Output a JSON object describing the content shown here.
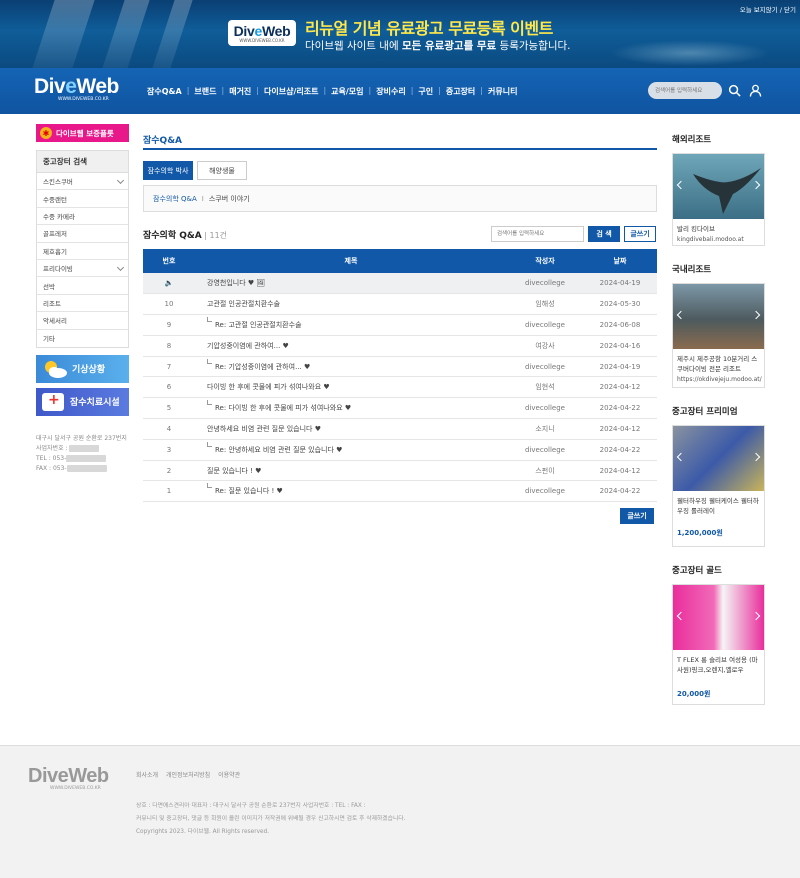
{
  "banner": {
    "logo": "DiveWeb",
    "logo_sub": "WWW.DIVEWEB.CO.KR",
    "headline": "리뉴얼 기념 유료광고 무료등록 이벤트",
    "sub_pre": "다이브웹 사이트 내에 ",
    "sub_bold": "모든 유료광고를 무료",
    "sub_post": " 등록가능합니다.",
    "top_links": "오늘 보지않기 / 닫기"
  },
  "nav": {
    "logo": "DiveWeb",
    "logo_sub": "WWW.DIVEWEB.CO.KR",
    "menu": [
      "잠수Q&A",
      "브랜드",
      "매거진",
      "다이브샵/리조트",
      "교육/모임",
      "장비수리",
      "구인",
      "중고장터",
      "커뮤니티"
    ],
    "search_placeholder": "검색어를 입력하세요"
  },
  "left": {
    "guarantee_btn": "다이브웹 보증플롯",
    "box_title": "중고장터 검색",
    "items": [
      "스킨스쿠버",
      "수중랜턴",
      "수중 카메라",
      "골프레저",
      "제호흡기",
      "프리다이빙",
      "선박",
      "리조트",
      "악세서리",
      "기타"
    ],
    "weather_btn": "기상상황",
    "hospital_btn": "잠수치료시설",
    "addr1": "대구시 달서구 공원 순환로 237번지",
    "addr2": "사업자번호 :",
    "tel": "TEL : 053-",
    "fax": "FAX : 053-"
  },
  "main": {
    "section_title": "잠수Q&A",
    "tabs": [
      "잠수의학 박사",
      "해양생물"
    ],
    "crumb1": "잠수의학 Q&A",
    "crumb_sep": "I",
    "crumb2": "스쿠버 이야기",
    "list_title": "잠수의학 Q&A",
    "list_count": " | 11건",
    "search_placeholder": "검색어를 입력하세요",
    "search_btn": "검 색",
    "write_btn": "글쓰기",
    "columns": [
      "번호",
      "제목",
      "작성자",
      "날짜"
    ],
    "rows": [
      {
        "num": "",
        "subject": "강영천입니다 ♥ 🖼",
        "author": "divecollege",
        "date": "2024-04-19",
        "notice": true,
        "reply": false
      },
      {
        "num": "10",
        "subject": "고관절 인공관절치환수술",
        "author": "임해성",
        "date": "2024-05-30",
        "notice": false,
        "reply": false
      },
      {
        "num": "9",
        "subject": "Re: 고관절 인공관절치환수술",
        "author": "divecollege",
        "date": "2024-06-08",
        "notice": false,
        "reply": true
      },
      {
        "num": "8",
        "subject": "기압성중이염에 관하여... ♥",
        "author": "여강사",
        "date": "2024-04-16",
        "notice": false,
        "reply": false
      },
      {
        "num": "7",
        "subject": "Re: 기압성중이염에 관하여... ♥",
        "author": "divecollege",
        "date": "2024-04-19",
        "notice": false,
        "reply": true
      },
      {
        "num": "6",
        "subject": "다이빙 한 후에 콧물에 피가 섞여나와요 ♥",
        "author": "임현석",
        "date": "2024-04-12",
        "notice": false,
        "reply": false
      },
      {
        "num": "5",
        "subject": "Re: 다이빙 한 후에 콧물에 피가 섞여나와요 ♥",
        "author": "divecollege",
        "date": "2024-04-22",
        "notice": false,
        "reply": true
      },
      {
        "num": "4",
        "subject": "안녕하세요 비염 관련 질문 있습니다 ♥",
        "author": "소지니",
        "date": "2024-04-12",
        "notice": false,
        "reply": false
      },
      {
        "num": "3",
        "subject": "Re: 안녕하세요 비염 관련 질문 있습니다 ♥",
        "author": "divecollege",
        "date": "2024-04-22",
        "notice": false,
        "reply": true
      },
      {
        "num": "2",
        "subject": "질문 있습니다 ! ♥",
        "author": "스펀이",
        "date": "2024-04-12",
        "notice": false,
        "reply": false
      },
      {
        "num": "1",
        "subject": "Re: 질문 있습니다 ! ♥",
        "author": "divecollege",
        "date": "2024-04-22",
        "notice": false,
        "reply": true
      }
    ],
    "write_btn_bottom": "글쓰기"
  },
  "right": {
    "sections": [
      {
        "title": "해외리조트",
        "text": "발리 킹다이브",
        "sub": "kingdivebali.modoo.at",
        "price": ""
      },
      {
        "title": "국내리조트",
        "text": "제주시 제주공항 10분거리 스쿠버다이빙 전문 리조트",
        "sub": "https://okdivejeju.modoo.at/",
        "price": ""
      },
      {
        "title": "중고장터 프리미엄",
        "text": "웰터하우징 웰터케이스 웰터하우징 롤러레이",
        "sub": "",
        "price": "1,200,000원"
      },
      {
        "title": "중고장터 골드",
        "text": "T FLEX 롱 슬리브 여성용 (마사원)핑크,오렌지,옐로우",
        "sub": "",
        "price": "20,000원"
      }
    ]
  },
  "footer": {
    "logo": "DiveWeb",
    "logo_sub": "WWW.DIVEWEB.CO.KR",
    "links": [
      "회사소개",
      "개인정보처리방침",
      "이용약관"
    ],
    "info1": "상호 : 다면에스견리아  대표자 :     대구시 달서구 공원 순환로 237번지  사업자번호 :            TEL :             FAX :",
    "info2": "커뮤니티 및 중고장터, 댓글 등 회원이 올린 이미지가 저작권에 위배될 경우 신고하시면 검토 후 삭제하겠습니다.",
    "info3": "Copyrights 2023. 다이브웹. All Rights reserved."
  },
  "colors": {
    "primary": "#1159a8",
    "pink": "#e8178a",
    "banner": "#0f5d99"
  }
}
